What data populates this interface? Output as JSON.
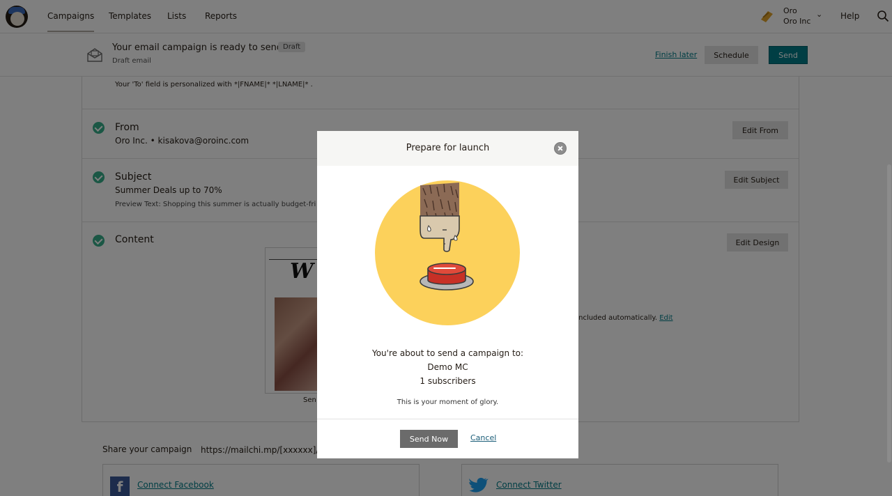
{
  "nav": {
    "items": [
      "Campaigns",
      "Templates",
      "Lists",
      "Reports"
    ],
    "account_name": "Oro",
    "account_org": "Oro Inc",
    "help": "Help"
  },
  "status": {
    "title": "Your email campaign is ready to send!",
    "badge": "Draft",
    "subtitle": "Draft email",
    "finish_later": "Finish later",
    "schedule": "Schedule",
    "send": "Send"
  },
  "checklist": {
    "to_note": "Your 'To' field is personalized with *|FNAME|* *|LNAME|* .",
    "from": {
      "title": "From",
      "value": "Oro Inc. • kisakova@oroinc.com",
      "button": "Edit From"
    },
    "subject": {
      "title": "Subject",
      "value": "Summer Deals up to 70%",
      "preview": "Preview Text: Shopping  this summer is actually budget-fri",
      "button": "Edit Subject"
    },
    "content": {
      "title": "Content",
      "button": "Edit Design",
      "preview_caption": "Sen",
      "footer_note": "e included automatically.",
      "footer_edit": "Edit"
    }
  },
  "share": {
    "label": "Share your campaign",
    "url": "https://mailchi.mp/[xxxxxx]/s",
    "facebook": "Connect Facebook",
    "twitter": "Connect Twitter"
  },
  "modal": {
    "title": "Prepare for launch",
    "send_to": "You're about to send a campaign to:",
    "list_name": "Demo MC",
    "subscribers": "1 subscribers",
    "glory": "This is your moment of glory.",
    "send_now": "Send Now",
    "cancel": "Cancel"
  },
  "colors": {
    "accent": "#007c89",
    "illustration_bg": "#fcd15b",
    "success": "#37ae8a"
  }
}
